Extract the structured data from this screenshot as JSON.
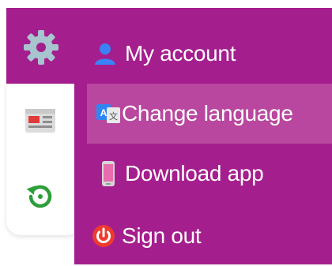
{
  "menu": {
    "items": [
      {
        "label": "My account",
        "icon": "user-icon"
      },
      {
        "label": "Change language",
        "icon": "translate-icon"
      },
      {
        "label": "Download app",
        "icon": "phone-icon"
      },
      {
        "label": "Sign out",
        "icon": "power-icon"
      }
    ],
    "active_index": 1
  },
  "sidebar": {
    "icons": [
      "settings-gear-icon",
      "news-icon",
      "history-icon"
    ]
  },
  "colors": {
    "menu_bg": "#a51e8e",
    "menu_active_bg": "#b9479f",
    "text": "#ffffff"
  }
}
